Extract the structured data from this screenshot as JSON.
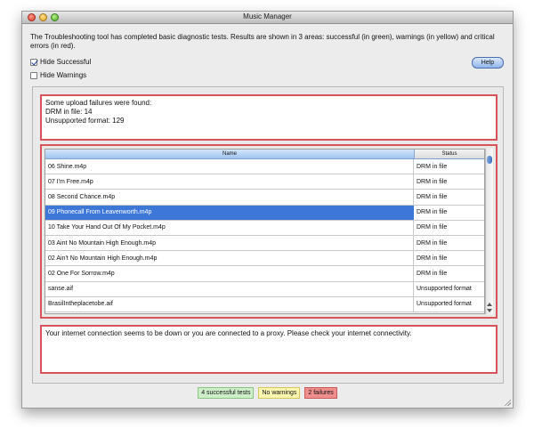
{
  "window": {
    "title": "Music Manager"
  },
  "intro_text": "The Troubleshooting tool has completed basic diagnostic tests.  Results are shown in 3 areas: successful (in green), warnings (in yellow) and critical errors (in red).",
  "options": {
    "hide_successful": {
      "label": "Hide Successful",
      "checked": true
    },
    "hide_warnings": {
      "label": "Hide Warnings",
      "checked": false
    }
  },
  "help_button": "Help",
  "upload_summary": {
    "line1": "Some upload failures were found:",
    "line2": "DRM in file: 14",
    "line3": "Unsupported format: 129"
  },
  "table": {
    "columns": {
      "name": "Name",
      "status": "Status"
    },
    "rows": [
      {
        "name": "06 Shine.m4p",
        "status": "DRM in file"
      },
      {
        "name": "07 I'm Free.m4p",
        "status": "DRM in file"
      },
      {
        "name": "08 Second Chance.m4p",
        "status": "DRM in file"
      },
      {
        "name": "09 Phonecall From Leavenworth.m4p",
        "status": "DRM in file",
        "selected": true
      },
      {
        "name": "10 Take Your Hand Out Of My Pocket.m4p",
        "status": "DRM in file"
      },
      {
        "name": "03 Aint No Mountain High Enough.m4p",
        "status": "DRM in file"
      },
      {
        "name": "02 Ain't No Mountain High Enough.m4p",
        "status": "DRM in file"
      },
      {
        "name": "02 One For Sorrow.m4p",
        "status": "DRM in file"
      },
      {
        "name": "sanse.aif",
        "status": "Unsupported format"
      },
      {
        "name": "BrasilIntheplacetobe.aif",
        "status": "Unsupported format"
      }
    ]
  },
  "connection_message": "Your internet connection seems to be down or you are connected to a proxy. Please check your internet connectivity.",
  "summary": {
    "successful": "4 successful tests",
    "warnings": "No warnings",
    "failures": "2 failures"
  },
  "colors": {
    "error_border": "#d9545a",
    "selection": "#3d78d8",
    "success": "#cdeec9",
    "warning": "#fbf6b0",
    "failure": "#f08e8e"
  }
}
